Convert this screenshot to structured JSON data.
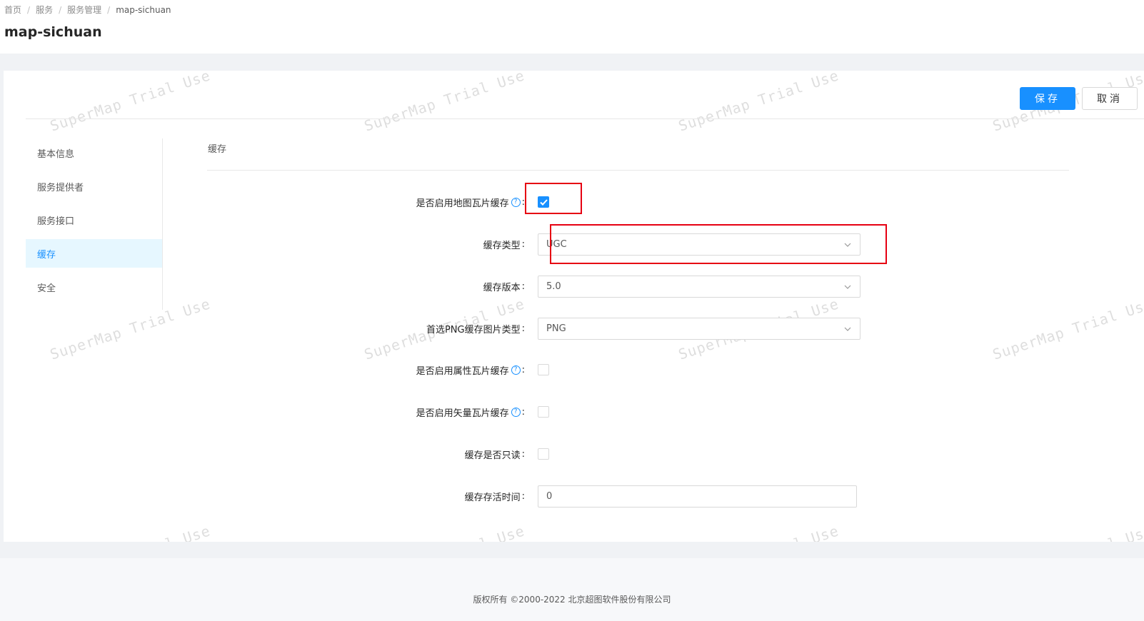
{
  "breadcrumb": [
    "首页",
    "服务",
    "服务管理",
    "map-sichuan"
  ],
  "page_title": "map-sichuan",
  "buttons": {
    "save": "保存",
    "cancel": "取消"
  },
  "side_nav": [
    {
      "label": "基本信息",
      "active": false
    },
    {
      "label": "服务提供者",
      "active": false
    },
    {
      "label": "服务接口",
      "active": false
    },
    {
      "label": "缓存",
      "active": true
    },
    {
      "label": "安全",
      "active": false
    }
  ],
  "section_title": "缓存",
  "form": {
    "enable_map_tile_cache": {
      "label": "是否启用地图瓦片缓存",
      "checked": true
    },
    "cache_type": {
      "label": "缓存类型",
      "value": "UGC"
    },
    "cache_version": {
      "label": "缓存版本",
      "value": "5.0"
    },
    "png_type": {
      "label": "首选PNG缓存图片类型",
      "value": "PNG"
    },
    "enable_attr_tile_cache": {
      "label": "是否启用属性瓦片缓存",
      "checked": false
    },
    "enable_vector_tile_cache": {
      "label": "是否启用矢量瓦片缓存",
      "checked": false
    },
    "readonly": {
      "label": "缓存是否只读",
      "checked": false
    },
    "ttl": {
      "label": "缓存存活时间",
      "value": "0"
    }
  },
  "watermark_text": "SuperMap Trial Use",
  "footer": "版权所有 ©2000-2022 北京超图软件股份有限公司",
  "colors": {
    "primary": "#1890ff",
    "highlight": "#e60012"
  }
}
